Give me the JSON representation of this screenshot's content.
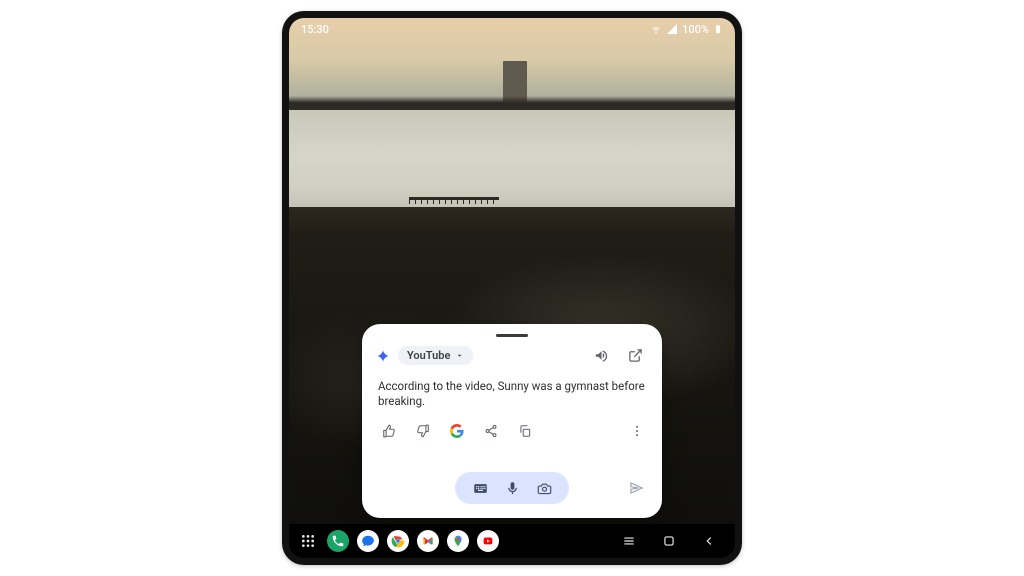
{
  "statusbar": {
    "time": "15:30",
    "battery": "100%"
  },
  "card": {
    "source_chip": "YouTube",
    "response": "According to the video, Sunny was a gymnast before breaking.",
    "icons": {
      "spark": "gemini-spark-icon",
      "speaker": "speaker-icon",
      "open": "open-in-new-icon",
      "thumb_up": "thumb-up-icon",
      "thumb_down": "thumb-down-icon",
      "google": "google-logo-icon",
      "share": "share-icon",
      "copy": "copy-icon",
      "more": "more-vert-icon",
      "keyboard": "keyboard-icon",
      "mic": "mic-icon",
      "camera": "camera-icon",
      "send": "send-icon"
    }
  },
  "taskbar": {
    "apps_button": "apps-grid-icon",
    "dock": [
      {
        "name": "phone-app-icon"
      },
      {
        "name": "messages-app-icon"
      },
      {
        "name": "chrome-app-icon"
      },
      {
        "name": "gmail-app-icon"
      },
      {
        "name": "maps-app-icon"
      },
      {
        "name": "youtube-app-icon"
      }
    ],
    "nav": {
      "recents": "recents-icon",
      "home": "home-icon",
      "back": "back-icon"
    }
  }
}
